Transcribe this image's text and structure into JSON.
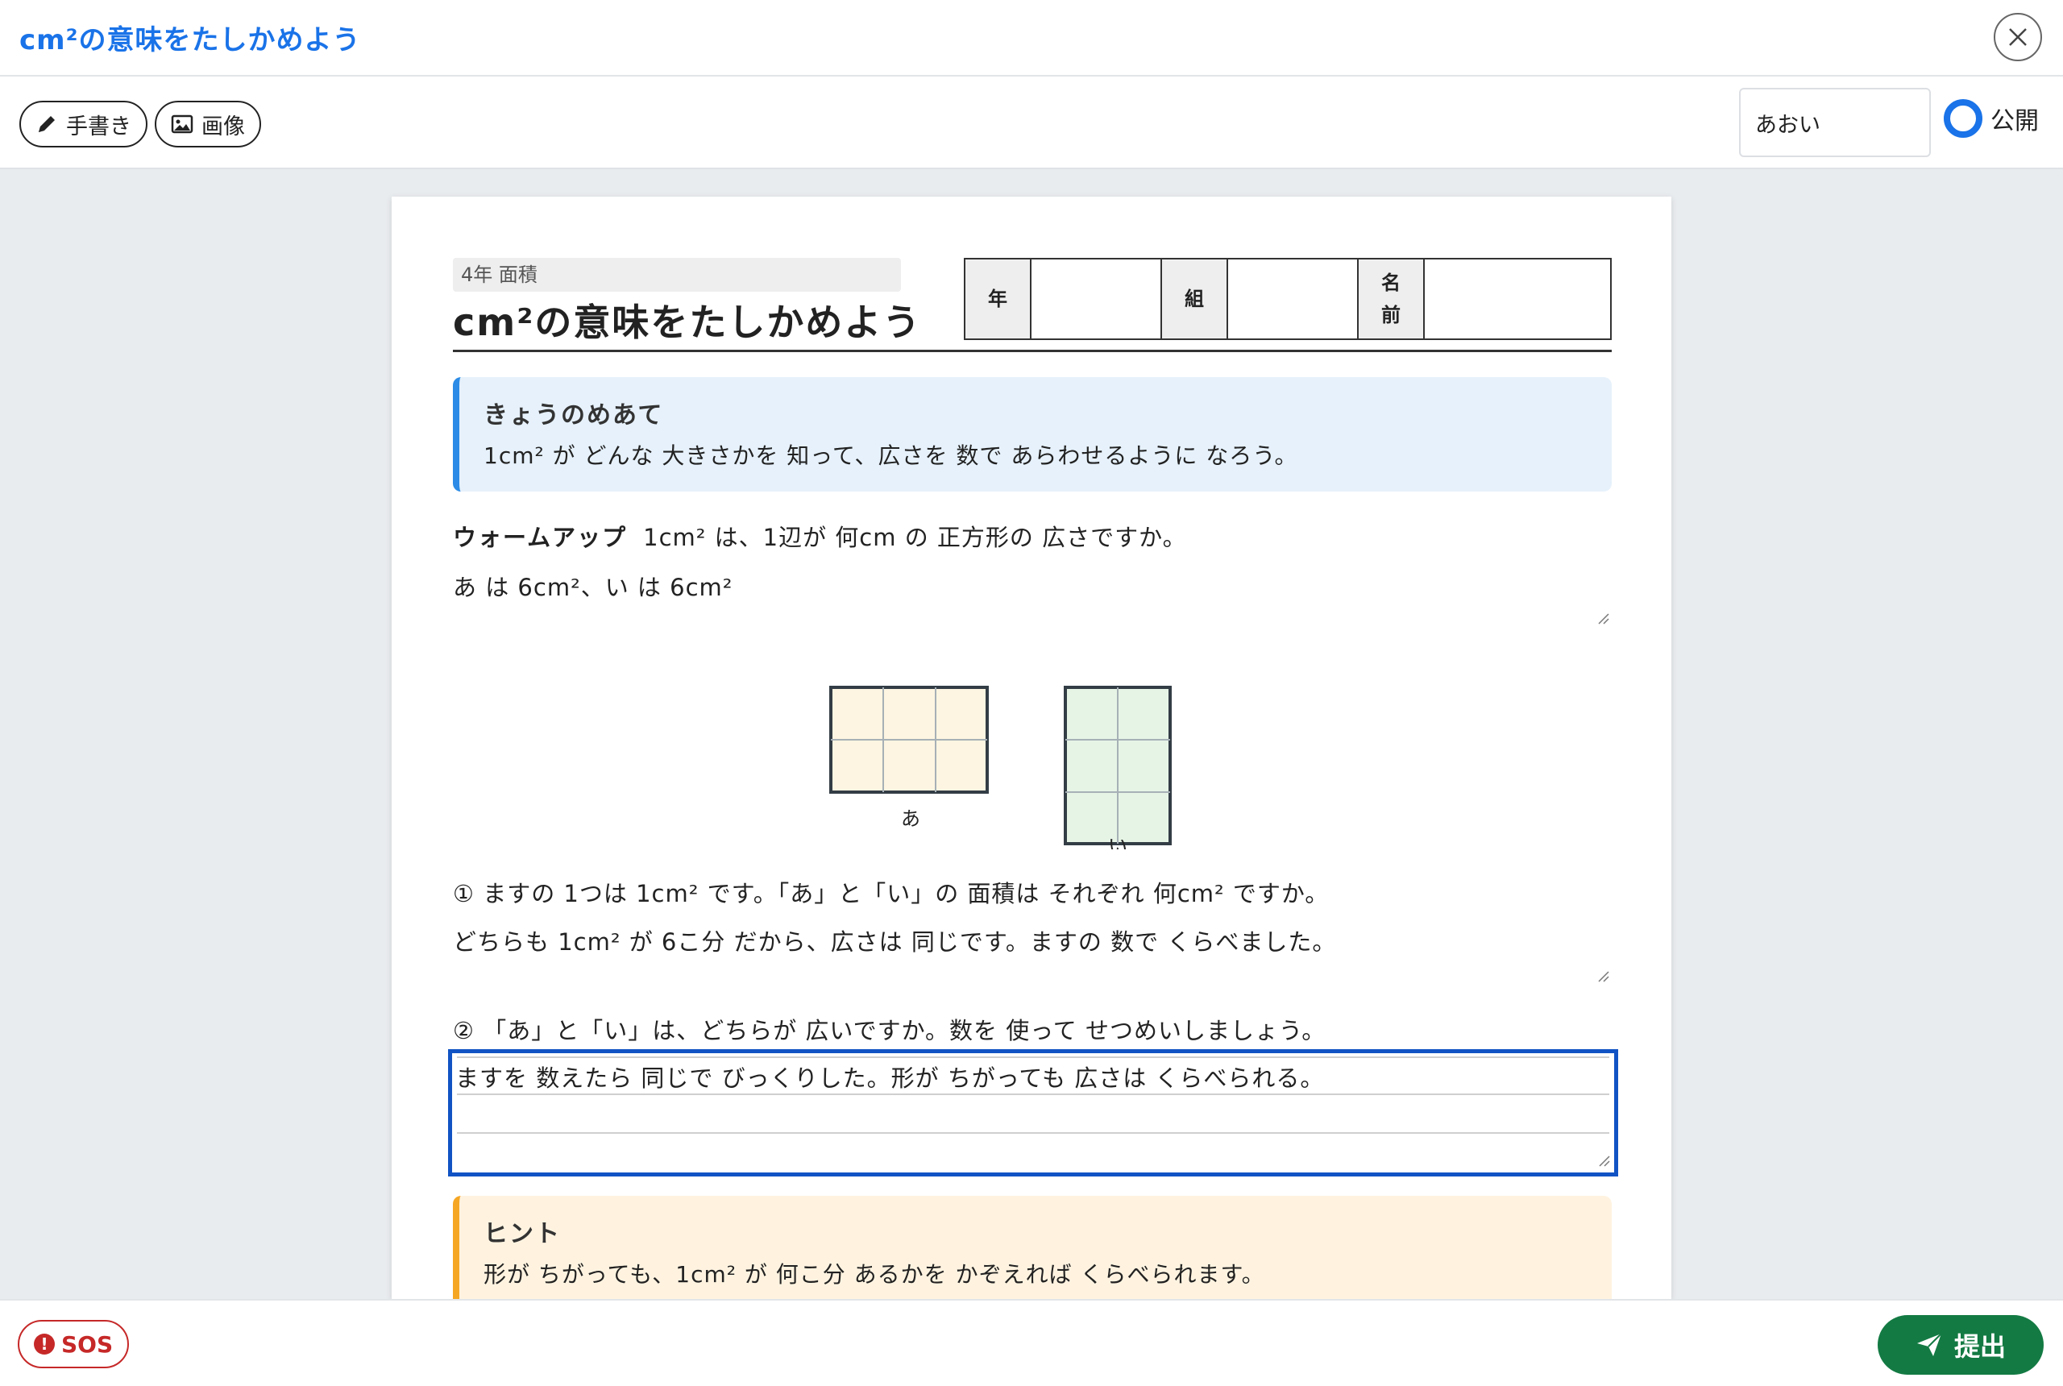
{
  "header": {
    "title": "cm²の意味をたしかめよう"
  },
  "toolbar": {
    "handwriting_label": "手書き",
    "image_label": "画像",
    "student_name": "あおい",
    "publish_label": "公開"
  },
  "sheet": {
    "grade_tag": "4年 面積",
    "title": "cm²の意味をたしかめよう",
    "info_labels": {
      "year": "年",
      "class": "組",
      "name_1": "名",
      "name_2": "前"
    },
    "goal": {
      "heading": "きょうのめあて",
      "text": "1cm² が どんな 大きさかを 知って、広さを 数で あらわせるように なろう。"
    },
    "warmup": {
      "label": "ウォームアップ",
      "question": "1cm² は、1辺が 何cm の 正方形の 広さですか。",
      "answer": "あ は 6cm²、い は 6cm²"
    },
    "figures": {
      "label_a": "あ",
      "label_i": "い"
    },
    "q1": {
      "question": "① ますの 1つは 1cm² です。「あ」と「い」の 面積は それぞれ 何cm² ですか。",
      "answer": "どちらも 1cm² が 6こ分 だから、広さは 同じです。ますの 数で くらべました。"
    },
    "q2": {
      "question": "② 「あ」と「い」は、どちらが 広いですか。数を 使って せつめいしましょう。",
      "answer": "ますを 数えたら 同じで びっくりした。形が ちがっても 広さは くらべられる。"
    },
    "hint": {
      "heading": "ヒント",
      "text": "形が ちがっても、1cm² が 何こ分 あるかを かぞえれば くらべられます。"
    }
  },
  "footer": {
    "sos_label": "SOS",
    "submit_label": "提出"
  },
  "colors": {
    "accent": "#1a73e8",
    "goal_bg": "#e6f1fb",
    "hint_bg": "#fff3e0",
    "submit_green": "#137a43",
    "sos_red": "#c62828",
    "fig_a_fill": "#fdf5e1",
    "fig_i_fill": "#e6f4e6"
  },
  "icons": {
    "close": "close-icon",
    "pencil": "pencil-icon",
    "image": "image-icon",
    "alert": "alert-icon",
    "send": "send-icon"
  }
}
